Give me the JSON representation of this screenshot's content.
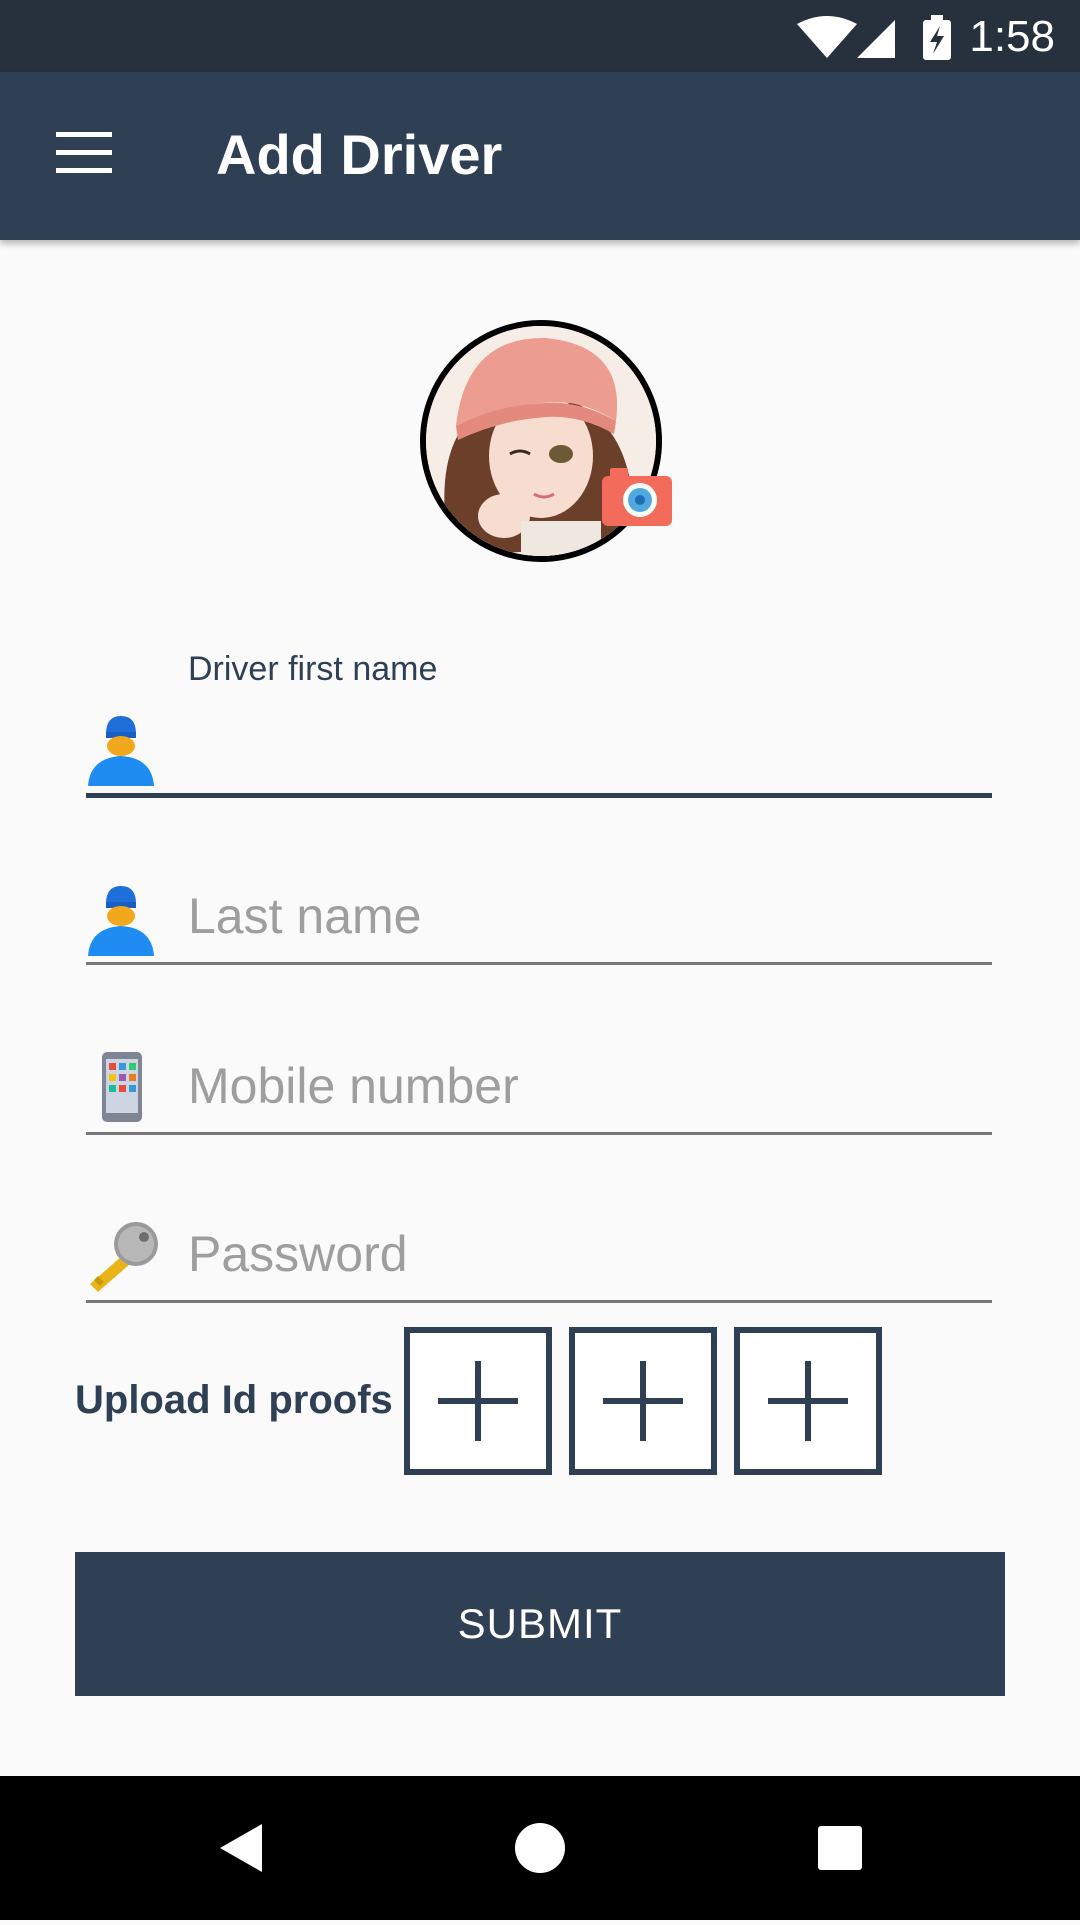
{
  "status_bar": {
    "time": "1:58",
    "icons": [
      "wifi-icon",
      "signal-icon",
      "battery-charging-icon"
    ]
  },
  "app_bar": {
    "title": "Add Driver",
    "menu_icon": "hamburger-menu-icon"
  },
  "avatar": {
    "image": "profile-photo",
    "edit_icon": "camera-icon"
  },
  "form": {
    "first_name": {
      "label": "Driver first name",
      "value": "",
      "icon": "driver-person-icon"
    },
    "last_name": {
      "placeholder": "Last name",
      "icon": "driver-person-icon"
    },
    "mobile": {
      "placeholder": "Mobile number",
      "icon": "mobile-phone-icon"
    },
    "password": {
      "placeholder": "Password",
      "icon": "key-icon"
    }
  },
  "upload": {
    "label": "Upload Id proofs",
    "slots": 3,
    "slot_icon": "plus-icon"
  },
  "submit_label": "SUBMIT",
  "colors": {
    "primary": "#2f3f54",
    "status_bar": "#27303d",
    "camera": "#f26b5b"
  },
  "nav_bar": {
    "buttons": [
      "back-icon",
      "home-icon",
      "recents-icon"
    ]
  }
}
